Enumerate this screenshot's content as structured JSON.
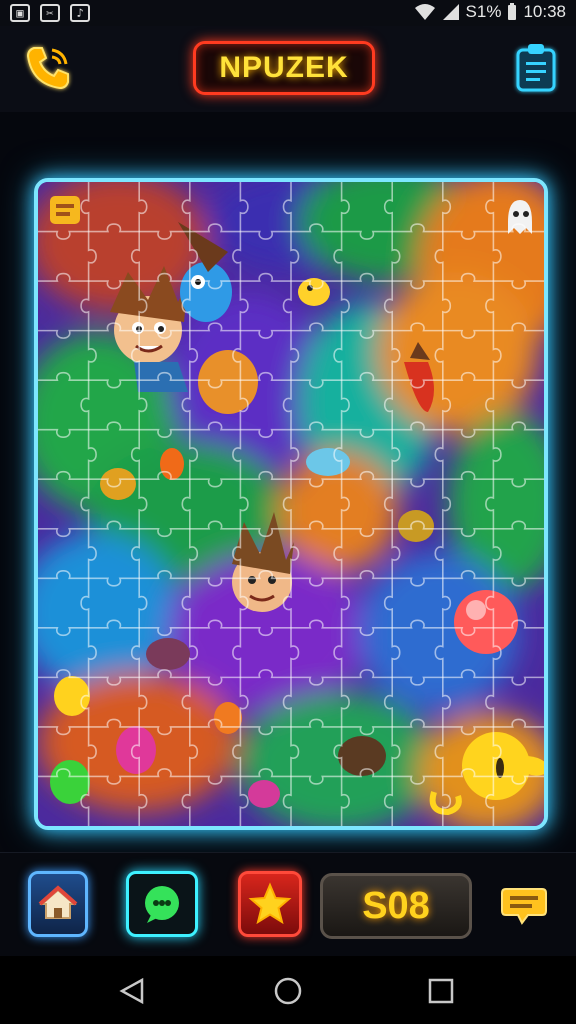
{
  "status_bar": {
    "battery_text": "S1%",
    "time": "10:38",
    "icons": [
      "gallery-icon",
      "app-icon",
      "media-icon",
      "wifi-icon",
      "signal-icon",
      "battery-icon"
    ]
  },
  "header": {
    "title": "NPUZEK",
    "left_icon": "phone-icon",
    "right_icon": "clipboard-icon",
    "title_border_color": "#ff3b20",
    "title_text_color": "#ffe23a"
  },
  "board": {
    "grid_rows": 13,
    "grid_cols": 10,
    "border_color": "#7de6ff",
    "pieces": [
      "cartoon-boy-character",
      "blue-fish-character",
      "yellow-fish-character",
      "red-carrot-character",
      "red-bubble",
      "yellow-blob-character",
      "ghost-character",
      "spiky-boy-character"
    ]
  },
  "bottom_bar": {
    "score": "S08",
    "buttons": [
      "home-icon",
      "chat-icon",
      "star-icon",
      "message-icon"
    ]
  },
  "nav_bar": {
    "items": [
      "back-icon",
      "home-circle-icon",
      "recents-icon"
    ]
  }
}
